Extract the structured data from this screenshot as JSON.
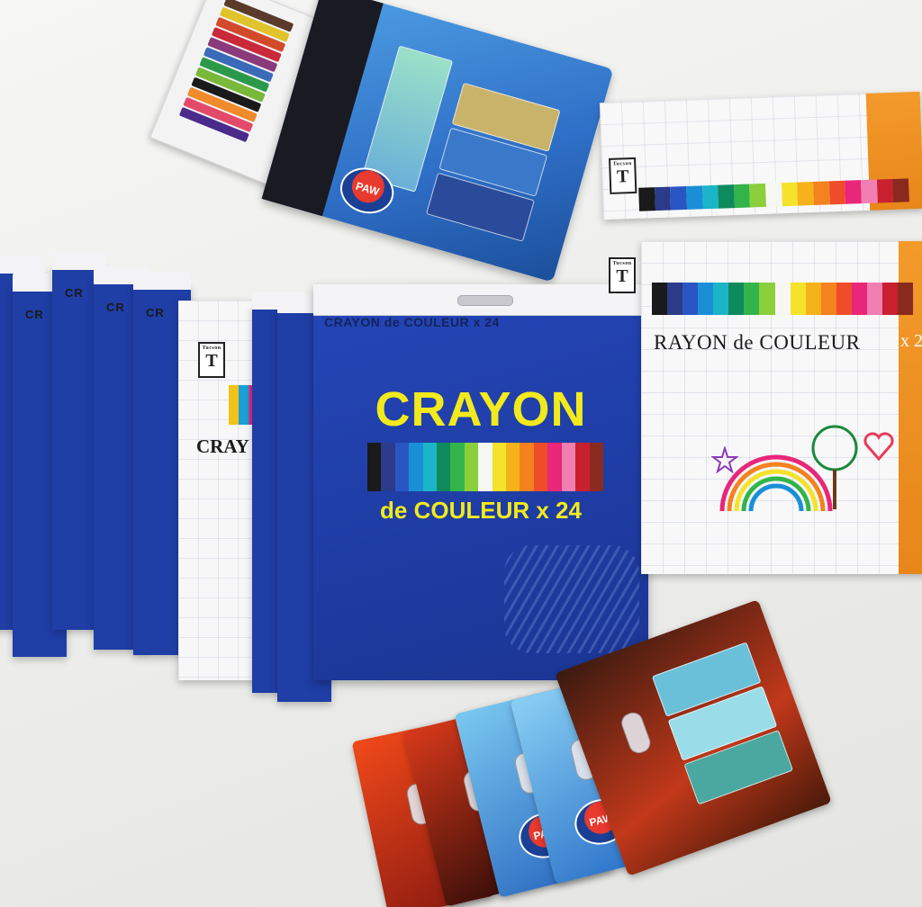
{
  "scene": {
    "description_free": true,
    "background_color": "#f1f1ef"
  },
  "main_box": {
    "top_strip": "CRAYON de COULEUR x 24",
    "title": "CRAYON",
    "subtitle": "de COULEUR x 24",
    "color_blue": "#1f3ea6",
    "color_yellow": "#f2ea1c"
  },
  "stack_boxes": {
    "label": "CR"
  },
  "white_box": {
    "label": "CRAY"
  },
  "right_box": {
    "label": "RAYON de COULEUR",
    "count": "x 2",
    "accent": "#f39a2b"
  },
  "logos": {
    "brand_small": "Tucson",
    "brand_letter": "T"
  },
  "eraser_cards": {
    "badge_text": "PAW"
  },
  "pencil_colors": [
    "#1a1a1a",
    "#2c3a8a",
    "#2a56c4",
    "#1a8fd8",
    "#1bb5c9",
    "#0f8a5c",
    "#33b44a",
    "#8bcf3c",
    "#f7f7f2",
    "#f5e22a",
    "#f6b21a",
    "#f3821f",
    "#ef4c2a",
    "#e8267a",
    "#f27fb2",
    "#c9202f",
    "#8a2a1e"
  ]
}
